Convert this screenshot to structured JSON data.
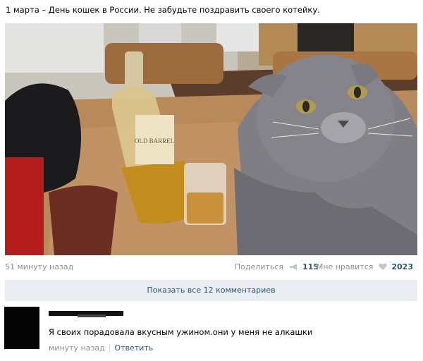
{
  "post": {
    "text": "1 марта – День кошек в России. Не забудьте поздравить своего котейку.",
    "time": "51 минуту назад",
    "share_label": "Поделиться",
    "share_count": "115",
    "like_label": "Мне нравится",
    "like_count": "2023"
  },
  "comments": {
    "show_all": "Показать все 12 комментариев"
  },
  "comment": {
    "text": "Я своих порадовала вкусным ужином.они у меня не алкашки",
    "time": "минуту назад",
    "reply": "Ответить"
  },
  "photo": {
    "bottle_label": "OLD BARREL"
  },
  "colors": {
    "link": "#2b587a",
    "muted": "#8b9097",
    "panel": "#e9edf1"
  }
}
